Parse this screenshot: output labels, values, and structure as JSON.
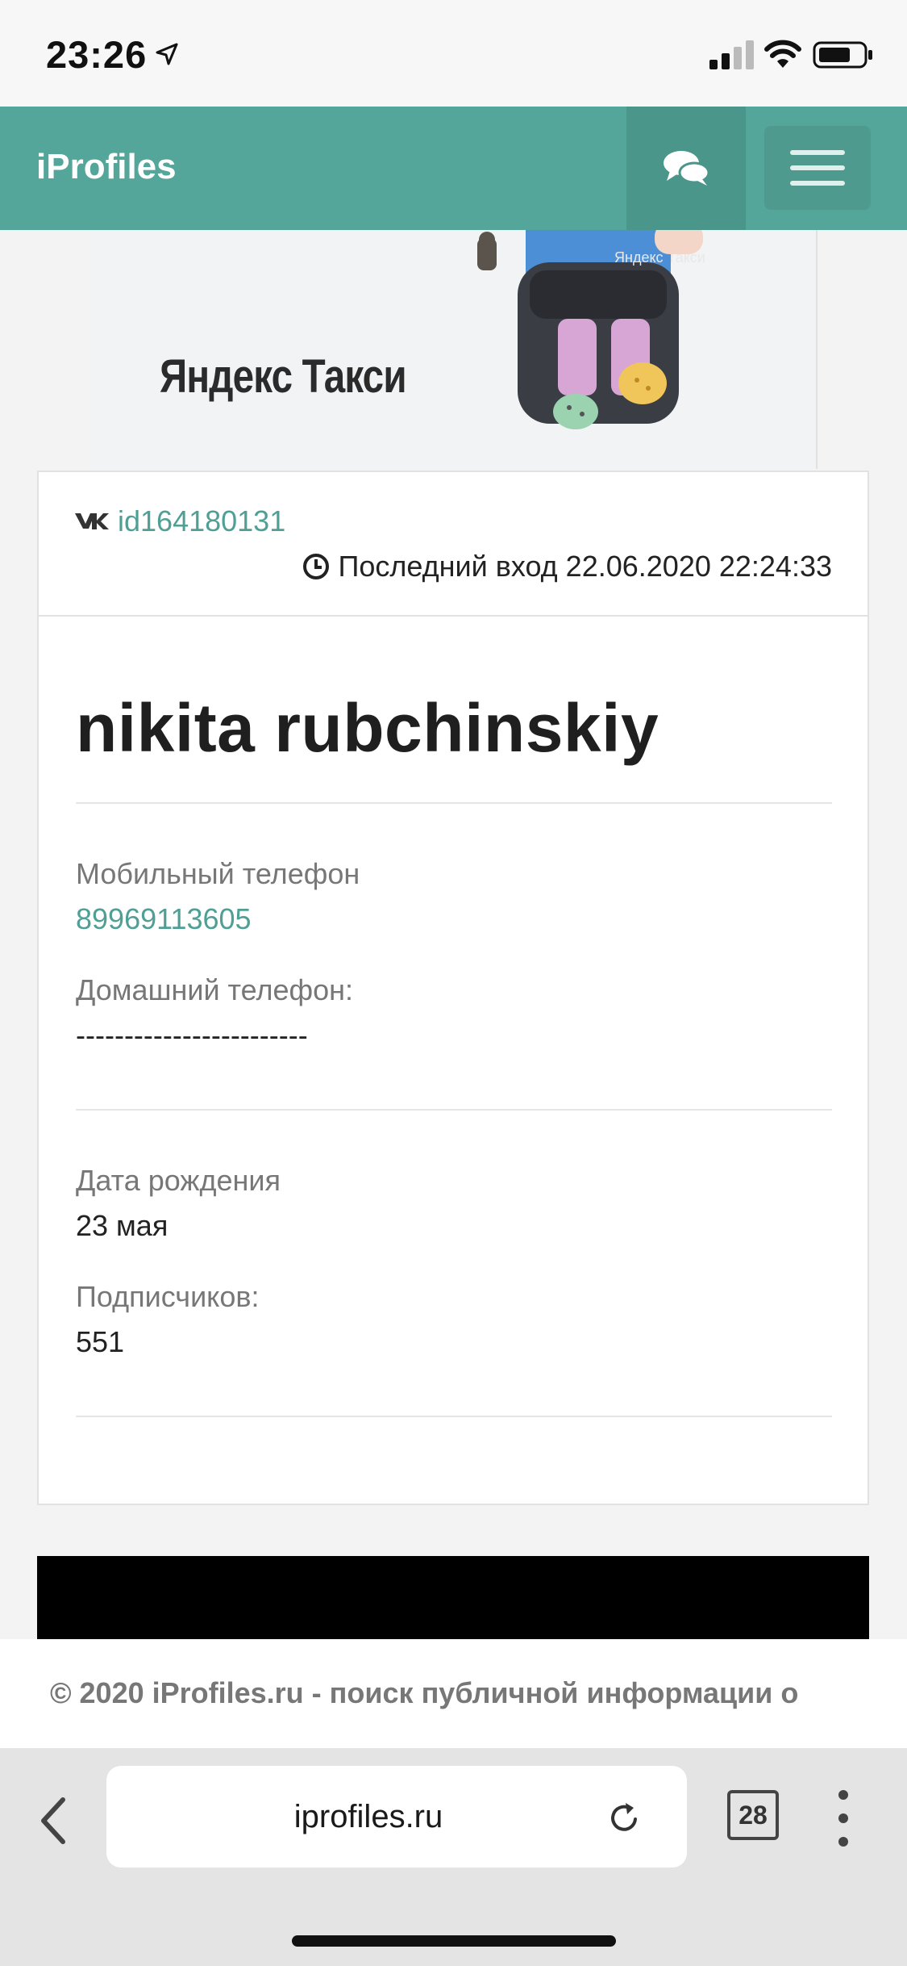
{
  "status_bar": {
    "time": "23:26",
    "icons": [
      "location-arrow-icon",
      "cellular-signal-icon",
      "wifi-icon",
      "battery-icon"
    ]
  },
  "navbar": {
    "brand": "iProfiles",
    "chat_icon": "chat-bubbles-icon",
    "menu_icon": "hamburger-menu-icon",
    "color": "#54a59a"
  },
  "banner": {
    "text": "Яндекс Такси",
    "bag_text": "Яндекс Такси"
  },
  "profile": {
    "vk_icon": "vk-icon",
    "vk_id": "id164180131",
    "clock_icon": "clock-icon",
    "last_login": "Последний вход 22.06.2020 22:24:33",
    "name": "nikita rubchinskiy",
    "fields": [
      {
        "label": "Мобильный телефон",
        "value": "89969113605",
        "is_link": true
      },
      {
        "label": "Домашний телефон:",
        "value": "------------------------",
        "is_link": false
      },
      {
        "label": "Дата рождения",
        "value": "23 мая",
        "is_link": false
      },
      {
        "label": "Подписчиков:",
        "value": "551",
        "is_link": false
      }
    ]
  },
  "footer": {
    "text": "© 2020 iProfiles.ru - поиск публичной информации о"
  },
  "browser": {
    "url": "iprofiles.ru",
    "tab_count": "28",
    "icons": [
      "back-arrow-icon",
      "reload-icon",
      "tabs-icon",
      "more-vertical-icon"
    ]
  },
  "colors": {
    "accent": "#54a59a",
    "link": "#4f9f95"
  }
}
